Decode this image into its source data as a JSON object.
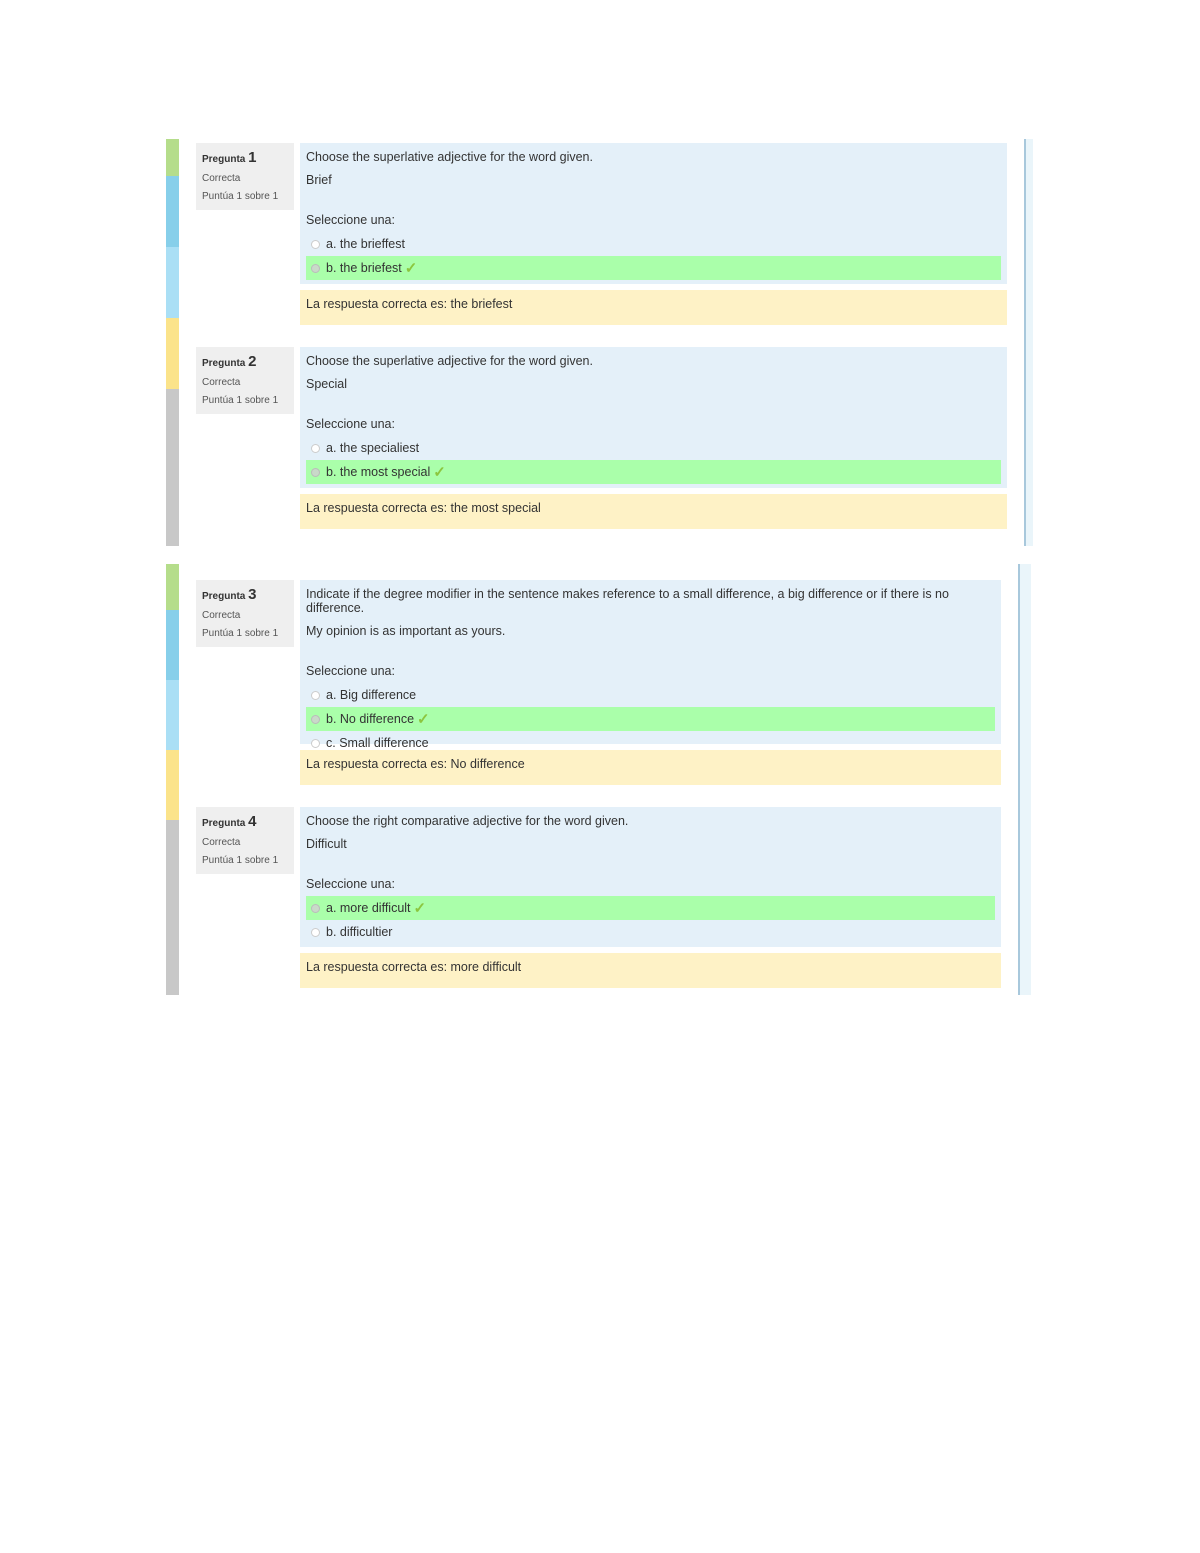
{
  "labels": {
    "question_word": "Pregunta",
    "select_prompt": "Seleccione una:",
    "correct_answer_prefix": "La respuesta correcta es: "
  },
  "questions": [
    {
      "number": "1",
      "state": "Correcta",
      "grade": "Puntúa 1 sobre 1",
      "text": "Choose the superlative adjective for the word given.",
      "word": "Brief",
      "prompt": "Seleccione una:",
      "answers": [
        {
          "label": "a. the brieffest",
          "correct": false
        },
        {
          "label": "b. the briefest",
          "correct": true
        }
      ],
      "feedback": "La respuesta correcta es: the briefest"
    },
    {
      "number": "2",
      "state": "Correcta",
      "grade": "Puntúa 1 sobre 1",
      "text": "Choose the superlative adjective for the word given.",
      "word": "Special",
      "prompt": "Seleccione una:",
      "answers": [
        {
          "label": "a. the specialiest",
          "correct": false
        },
        {
          "label": "b. the most special",
          "correct": true
        }
      ],
      "feedback": "La respuesta correcta es: the most special"
    },
    {
      "number": "3",
      "state": "Correcta",
      "grade": "Puntúa 1 sobre 1",
      "text": "Indicate if the degree modifier in the sentence makes reference to a small difference, a big difference or if there is no difference.",
      "word": "My opinion is as important as yours.",
      "prompt": "Seleccione una:",
      "answers": [
        {
          "label": "a. Big difference",
          "correct": false
        },
        {
          "label": "b. No difference",
          "correct": true
        },
        {
          "label": "c. Small difference",
          "correct": false
        }
      ],
      "feedback": "La respuesta correcta es: No difference"
    },
    {
      "number": "4",
      "state": "Correcta",
      "grade": "Puntúa 1 sobre 1",
      "text": "Choose the right comparative adjective for the word given.",
      "word": "Difficult",
      "prompt": "Seleccione una:",
      "answers": [
        {
          "label": "a. more difficult",
          "correct": true
        },
        {
          "label": "b. difficultier",
          "correct": false
        }
      ],
      "feedback": "La respuesta correcta es: more difficult"
    }
  ],
  "icons": {
    "check": "✓"
  },
  "colors": {
    "correct_bg": "#aaffaa",
    "formulation_bg": "#e4f0f9",
    "feedback_bg": "#fef2c6",
    "info_bg": "#efefef",
    "check": "#8cc63f"
  }
}
